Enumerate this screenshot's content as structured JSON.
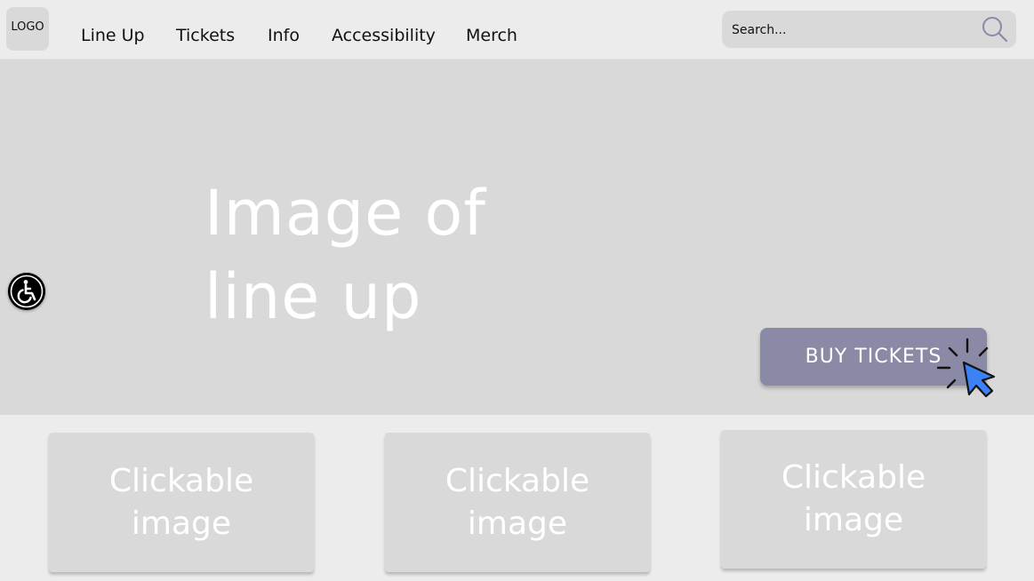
{
  "header": {
    "logo": "LOGO",
    "nav": [
      {
        "label": "Line Up"
      },
      {
        "label": "Tickets"
      },
      {
        "label": "Info"
      },
      {
        "label": "Accessibility"
      },
      {
        "label": "Merch"
      }
    ],
    "search": {
      "placeholder": "Search..."
    }
  },
  "hero": {
    "text": "Image of line up",
    "cta_label": "BUY TICKETS"
  },
  "cards": [
    {
      "label": "Clickable image"
    },
    {
      "label": "Clickable image"
    },
    {
      "label": "Clickable image"
    }
  ],
  "colors": {
    "background": "#ececec",
    "placeholder": "#d9d9d9",
    "cta": "#8a8aa6",
    "cursor_accent": "#3b82f6"
  },
  "icons": {
    "search": "search-icon",
    "accessibility": "wheelchair-icon",
    "cursor": "click-cursor-icon"
  }
}
